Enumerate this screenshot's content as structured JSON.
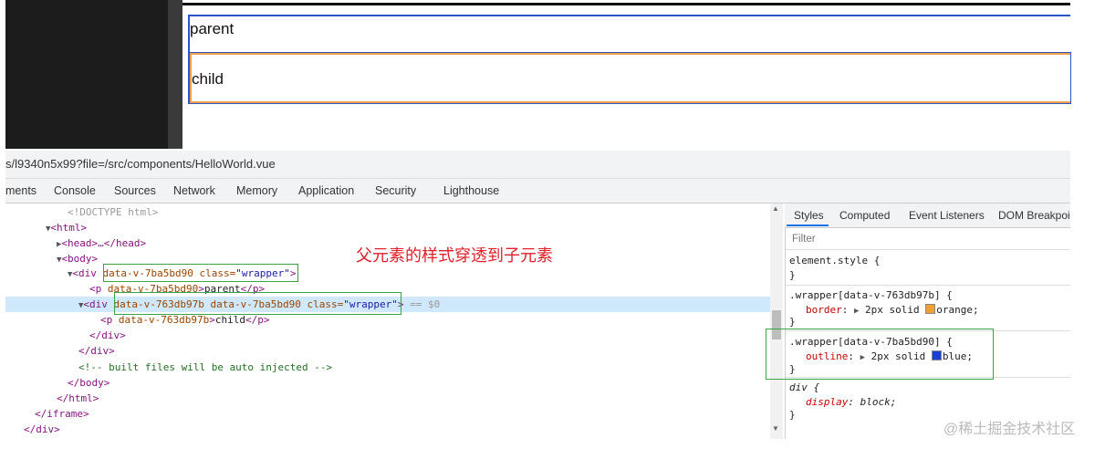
{
  "preview": {
    "parent_text": "parent",
    "child_text": "child",
    "outline_color": "#2a55c8",
    "border_color": "#f0a048"
  },
  "devtools": {
    "url": "s/l9340n5x99?file=/src/components/HelloWorld.vue",
    "tabs": [
      "ments",
      "Console",
      "Sources",
      "Network",
      "Memory",
      "Application",
      "Security",
      "Lighthouse"
    ],
    "dom": {
      "doctype": "<!DOCTYPE html>",
      "html_open": "<html>",
      "head": "<head>…</head>",
      "body_open": "<body>",
      "div1_tag": "<div ",
      "div1_attr1": "data-v-7ba5bd90",
      "div1_attr2_name": "class=",
      "div1_attr2_val": "\"wrapper\"",
      "p1_tag": "<p ",
      "p1_attr": "data-v-7ba5bd90",
      "p1_text": "parent",
      "p1_close": "</p>",
      "div2_tag": "<div ",
      "div2_attr1": "data-v-763db97b",
      "div2_attr2": "data-v-7ba5bd90",
      "div2_attr3_name": "class=",
      "div2_attr3_val": "\"wrapper\"",
      "div2_eq": "== $0",
      "p2_tag": "<p ",
      "p2_attr": "data-v-763db97b",
      "p2_text": "child",
      "p2_close": "</p>",
      "div_close": "</div>",
      "div_close2": "</div>",
      "comment": "<!-- built files will be auto injected -->",
      "body_close": "</body>",
      "html_close": "</html>",
      "iframe_close": "</iframe>",
      "div_close3": "</div>"
    },
    "styles_tabs": [
      "Styles",
      "Computed",
      "Event Listeners",
      "DOM Breakpoi"
    ],
    "filter_placeholder": "Filter",
    "rules": {
      "element_style": "element.style {",
      "close": "}",
      "rule1_selector": ".wrapper[data-v-763db97b] {",
      "rule1_prop": "border",
      "rule1_value": "2px solid",
      "rule1_color_name": "orange;",
      "rule1_swatch": "#f0a030",
      "rule2_selector": ".wrapper[data-v-7ba5bd90] {",
      "rule2_prop": "outline",
      "rule2_value": "2px solid",
      "rule2_color_name": "blue;",
      "rule2_swatch": "#1a3ed8",
      "rule3_selector": "div {",
      "rule3_prop": "display",
      "rule3_value": "block;"
    }
  },
  "annotation": "父元素的样式穿透到子元素",
  "watermark": "@稀土掘金技术社区"
}
